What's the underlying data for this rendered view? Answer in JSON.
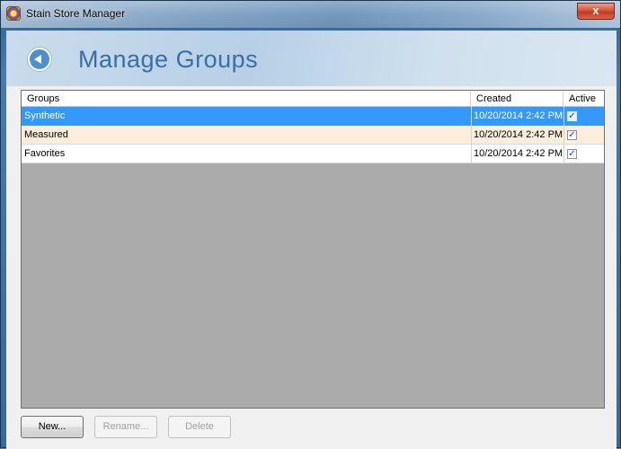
{
  "window": {
    "title": "Stain Store Manager",
    "close_label": "x"
  },
  "header": {
    "title": "Manage Groups"
  },
  "grid": {
    "columns": [
      "Groups",
      "Created",
      "Active"
    ],
    "rows": [
      {
        "name": "Synthetic",
        "created": "10/20/2014 2:42 PM",
        "active": true,
        "state": "selected"
      },
      {
        "name": "Measured",
        "created": "10/20/2014 2:42 PM",
        "active": true,
        "state": "alt"
      },
      {
        "name": "Favorites",
        "created": "10/20/2014 2:42 PM",
        "active": true,
        "state": "normal"
      }
    ],
    "check_glyph": "✓"
  },
  "buttons": {
    "new_label": "New...",
    "rename_label": "Rename...",
    "delete_label": "Delete"
  },
  "colors": {
    "selection": "#3399ff",
    "alt_row": "#fbeedc",
    "title_blue": "#3a6ea6",
    "grid_bg": "#ababab"
  }
}
